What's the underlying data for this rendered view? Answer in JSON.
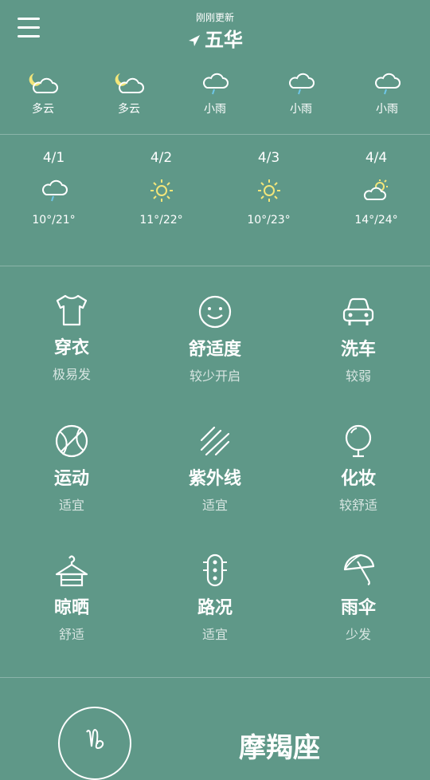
{
  "header": {
    "update_status": "刚刚更新",
    "city": "五华"
  },
  "hourly": [
    {
      "label": "多云",
      "icon": "cloudy-night-icon"
    },
    {
      "label": "多云",
      "icon": "cloudy-night-icon"
    },
    {
      "label": "小雨",
      "icon": "light-rain-icon"
    },
    {
      "label": "小雨",
      "icon": "light-rain-icon"
    },
    {
      "label": "小雨",
      "icon": "light-rain-icon"
    }
  ],
  "daily": [
    {
      "date": "4/1",
      "temp": "10°/21°",
      "icon": "light-rain-icon"
    },
    {
      "date": "4/2",
      "temp": "11°/22°",
      "icon": "sunny-icon"
    },
    {
      "date": "4/3",
      "temp": "10°/23°",
      "icon": "sunny-icon"
    },
    {
      "date": "4/4",
      "temp": "14°/24°",
      "icon": "partly-cloudy-icon"
    }
  ],
  "indices": [
    {
      "title": "穿衣",
      "value": "极易发",
      "icon": "tshirt-icon"
    },
    {
      "title": "舒适度",
      "value": "较少开启",
      "icon": "smiley-icon"
    },
    {
      "title": "洗车",
      "value": "较弱",
      "icon": "car-icon"
    },
    {
      "title": "运动",
      "value": "适宜",
      "icon": "basketball-icon"
    },
    {
      "title": "紫外线",
      "value": "适宜",
      "icon": "uv-icon"
    },
    {
      "title": "化妆",
      "value": "较舒适",
      "icon": "mirror-icon"
    },
    {
      "title": "晾晒",
      "value": "舒适",
      "icon": "hanger-icon"
    },
    {
      "title": "路况",
      "value": "适宜",
      "icon": "traffic-light-icon"
    },
    {
      "title": "雨伞",
      "value": "少发",
      "icon": "umbrella-icon"
    }
  ],
  "zodiac": {
    "symbol": "♑",
    "name": "摩羯座"
  },
  "colors": {
    "background": "#5f9888",
    "sun": "#f3e67a",
    "rain": "#6ec6e8"
  }
}
